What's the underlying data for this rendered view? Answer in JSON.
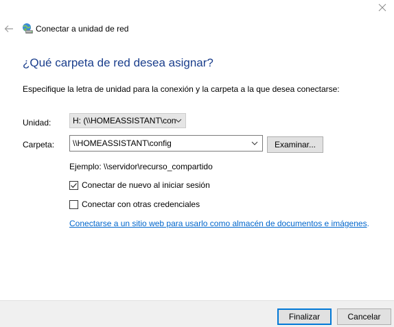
{
  "window": {
    "close_icon": "close-icon"
  },
  "header": {
    "back_icon": "back-arrow-icon",
    "app_icon": "network-drive-icon",
    "title": "Conectar a unidad de red"
  },
  "main": {
    "heading": "¿Qué carpeta de red desea asignar?",
    "instructions": "Especifique la letra de unidad para la conexión y la carpeta a la que desea conectarse:",
    "drive": {
      "label": "Unidad:",
      "selected": "H: (\\\\HOMEASSISTANT\\con"
    },
    "folder": {
      "label": "Carpeta:",
      "value": "\\\\HOMEASSISTANT\\config",
      "browse_label": "Examinar..."
    },
    "example": "Ejemplo: \\\\servidor\\recurso_compartido",
    "reconnect": {
      "label": "Conectar de nuevo al iniciar sesión",
      "checked": true
    },
    "other_credentials": {
      "label": "Conectar con otras credenciales",
      "checked": false
    },
    "link": {
      "text": "Conectarse a un sitio web para usarlo como almacén de documentos e imágenes",
      "suffix": "."
    }
  },
  "footer": {
    "finish_label": "Finalizar",
    "cancel_label": "Cancelar"
  },
  "colors": {
    "heading": "#1a3e8c",
    "link": "#0066cc",
    "accent": "#0078d7",
    "footer_bg": "#f0f0f0"
  }
}
